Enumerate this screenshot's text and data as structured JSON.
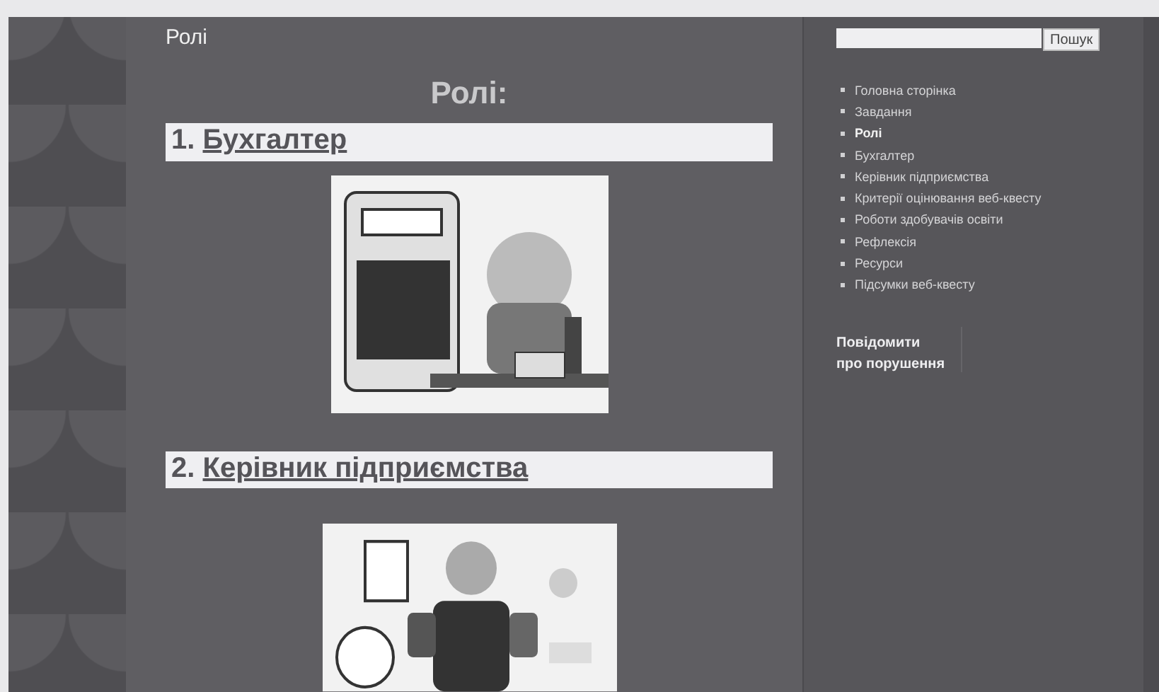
{
  "breadcrumb": "Ролі",
  "page_title": "Ролі:",
  "sections": [
    {
      "number": "1.",
      "link": "Бухгалтер"
    },
    {
      "number": "2.",
      "link": "Керівник підприємства"
    }
  ],
  "sidebar": {
    "search": {
      "button": "Пошук"
    },
    "nav": [
      {
        "label": "Головна сторінка",
        "selected": false
      },
      {
        "label": "Завдання",
        "selected": false
      },
      {
        "label": "Ролі",
        "selected": true
      },
      {
        "label": "Бухгалтер",
        "selected": false
      },
      {
        "label": "Керівник підприємства",
        "selected": false
      },
      {
        "label": "Критерії оцінювання веб-квесту",
        "selected": false
      },
      {
        "label": "Роботи здобувачів освіти",
        "selected": false
      },
      {
        "label": "Рефлексія",
        "selected": false
      },
      {
        "label": "Ресурси",
        "selected": false
      },
      {
        "label": "Підсумки веб-квесту",
        "selected": false
      }
    ],
    "report": "Повідомити про порушення"
  }
}
